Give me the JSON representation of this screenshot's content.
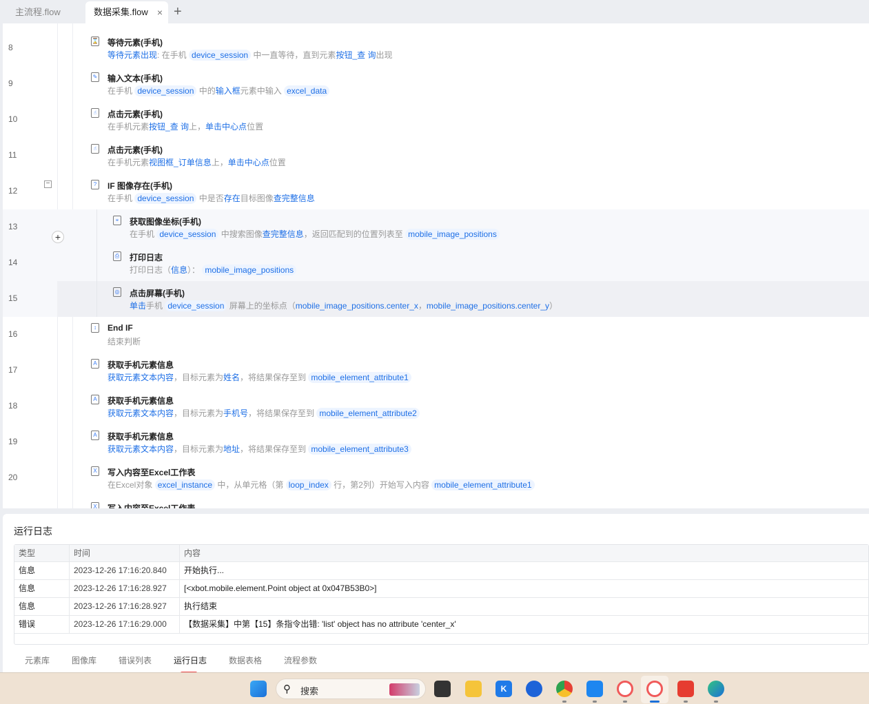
{
  "tabs": [
    {
      "label": "主流程.flow"
    },
    {
      "label": "数据采集.flow",
      "close": "×"
    }
  ],
  "add_tab": "+",
  "collapse": "−",
  "add_step": "+",
  "rows": [
    {
      "no": "8",
      "title": "等待元素(手机)",
      "icon": "hourglass-icon",
      "glyph": "⌛",
      "desc": [
        {
          "t": "等待元素出现",
          "k": "lk"
        },
        {
          "t": ": 在手机 ",
          "k": ""
        },
        {
          "t": "device_session",
          "k": "vr"
        },
        {
          "t": " 中一直等待，直到元素",
          "k": ""
        },
        {
          "t": "按钮_查 询",
          "k": "lk"
        },
        {
          "t": "出现",
          "k": ""
        }
      ]
    },
    {
      "no": "9",
      "title": "输入文本(手机)",
      "icon": "input-text-icon",
      "glyph": "✎",
      "desc": [
        {
          "t": "在手机 ",
          "k": ""
        },
        {
          "t": "device_session",
          "k": "vr"
        },
        {
          "t": " 中的",
          "k": ""
        },
        {
          "t": "输入框",
          "k": "lk"
        },
        {
          "t": "元素中输入 ",
          "k": ""
        },
        {
          "t": "excel_data",
          "k": "vr"
        }
      ]
    },
    {
      "no": "10",
      "title": "点击元素(手机)",
      "icon": "click-element-icon",
      "glyph": "☝",
      "desc": [
        {
          "t": "在手机元素",
          "k": ""
        },
        {
          "t": "按钮_查 询",
          "k": "lk"
        },
        {
          "t": "上，",
          "k": ""
        },
        {
          "t": "单击中心点",
          "k": "lk"
        },
        {
          "t": "位置",
          "k": ""
        }
      ]
    },
    {
      "no": "11",
      "title": "点击元素(手机)",
      "icon": "click-element-icon",
      "glyph": "☝",
      "desc": [
        {
          "t": "在手机元素",
          "k": ""
        },
        {
          "t": "视图框_订单信息",
          "k": "lk"
        },
        {
          "t": "上，",
          "k": ""
        },
        {
          "t": "单击中心点",
          "k": "lk"
        },
        {
          "t": "位置",
          "k": ""
        }
      ]
    },
    {
      "no": "12",
      "title": "IF 图像存在(手机)",
      "icon": "image-exists-icon",
      "glyph": "?",
      "desc": [
        {
          "t": "在手机 ",
          "k": ""
        },
        {
          "t": "device_session",
          "k": "vr"
        },
        {
          "t": " 中是否",
          "k": ""
        },
        {
          "t": "存在",
          "k": "lk"
        },
        {
          "t": "目标图像",
          "k": ""
        },
        {
          "t": "查完整信息",
          "k": "lk"
        }
      ]
    },
    {
      "no": "13",
      "title": "获取图像坐标(手机)",
      "icon": "image-coords-icon",
      "glyph": "⌖",
      "nested": true,
      "desc": [
        {
          "t": "在手机 ",
          "k": ""
        },
        {
          "t": "device_session",
          "k": "vr"
        },
        {
          "t": " 中搜索图像",
          "k": ""
        },
        {
          "t": "查完整信息",
          "k": "lk"
        },
        {
          "t": "，返回匹配到的位置列表至 ",
          "k": ""
        },
        {
          "t": "mobile_image_positions",
          "k": "vr"
        }
      ]
    },
    {
      "no": "14",
      "title": "打印日志",
      "icon": "printer-icon",
      "glyph": "⎙",
      "nested": true,
      "desc": [
        {
          "t": "打印日志（",
          "k": ""
        },
        {
          "t": "信息",
          "k": "lk"
        },
        {
          "t": "）： ",
          "k": ""
        },
        {
          "t": "mobile_image_positions",
          "k": "vr"
        }
      ]
    },
    {
      "no": "15",
      "title": "点击屏幕(手机)",
      "icon": "tap-screen-icon",
      "glyph": "◎",
      "nested": true,
      "selected": true,
      "desc": [
        {
          "t": "单击",
          "k": "lk"
        },
        {
          "t": "手机 ",
          "k": ""
        },
        {
          "t": "device_session",
          "k": "vr"
        },
        {
          "t": " 屏幕上的坐标点（",
          "k": ""
        },
        {
          "t": "mobile_image_positions.center_x",
          "k": "lk"
        },
        {
          "t": "，",
          "k": ""
        },
        {
          "t": "mobile_image_positions.center_y",
          "k": "lk"
        },
        {
          "t": "）",
          "k": ""
        }
      ]
    },
    {
      "no": "16",
      "title": "End IF",
      "icon": "end-if-icon",
      "glyph": "↕",
      "desc": [
        {
          "t": "结束判断",
          "k": ""
        }
      ]
    },
    {
      "no": "17",
      "title": "获取手机元素信息",
      "icon": "element-info-icon",
      "glyph": "A",
      "desc": [
        {
          "t": "获取元素文本内容",
          "k": "lk"
        },
        {
          "t": "，目标元素为",
          "k": ""
        },
        {
          "t": "姓名",
          "k": "lk"
        },
        {
          "t": "，将结果保存至到 ",
          "k": ""
        },
        {
          "t": "mobile_element_attribute1",
          "k": "vr"
        }
      ]
    },
    {
      "no": "18",
      "title": "获取手机元素信息",
      "icon": "element-info-icon",
      "glyph": "A",
      "desc": [
        {
          "t": "获取元素文本内容",
          "k": "lk"
        },
        {
          "t": "，目标元素为",
          "k": ""
        },
        {
          "t": "手机号",
          "k": "lk"
        },
        {
          "t": "，将结果保存至到 ",
          "k": ""
        },
        {
          "t": "mobile_element_attribute2",
          "k": "vr"
        }
      ]
    },
    {
      "no": "19",
      "title": "获取手机元素信息",
      "icon": "element-info-icon",
      "glyph": "A",
      "desc": [
        {
          "t": "获取元素文本内容",
          "k": "lk"
        },
        {
          "t": "，目标元素为",
          "k": ""
        },
        {
          "t": "地址",
          "k": "lk"
        },
        {
          "t": "，将结果保存至到 ",
          "k": ""
        },
        {
          "t": "mobile_element_attribute3",
          "k": "vr"
        }
      ]
    },
    {
      "no": "20",
      "title": "写入内容至Excel工作表",
      "icon": "excel-write-icon",
      "glyph": "X",
      "desc": [
        {
          "t": "在Excel对象 ",
          "k": ""
        },
        {
          "t": "excel_instance",
          "k": "vr"
        },
        {
          "t": " 中，从单元格（第 ",
          "k": ""
        },
        {
          "t": "loop_index",
          "k": "vr"
        },
        {
          "t": " 行，第2列）开始写入内容 ",
          "k": ""
        },
        {
          "t": "mobile_element_attribute1",
          "k": "vr"
        }
      ]
    },
    {
      "no": "21",
      "title": "写入内容至Excel工作表",
      "icon": "excel-write-icon",
      "glyph": "X",
      "desc": []
    }
  ],
  "log": {
    "title": "运行日志",
    "headers": [
      "类型",
      "时间",
      "内容"
    ],
    "rows": [
      [
        "信息",
        "2023-12-26 17:16:20.840",
        "开始执行..."
      ],
      [
        "信息",
        "2023-12-26 17:16:28.927",
        "[<xbot.mobile.element.Point object at 0x047B53B0>]"
      ],
      [
        "信息",
        "2023-12-26 17:16:28.927",
        "执行结束"
      ],
      [
        "错误",
        "2023-12-26 17:16:29.000",
        "【数据采集】中第【15】条指令出错:  'list' object has no attribute 'center_x'"
      ]
    ]
  },
  "bottom_tabs": [
    "元素库",
    "图像库",
    "错误列表",
    "运行日志",
    "数据表格",
    "流程参数"
  ],
  "active_bottom_tab": "运行日志",
  "taskbar": {
    "search": "搜索"
  }
}
